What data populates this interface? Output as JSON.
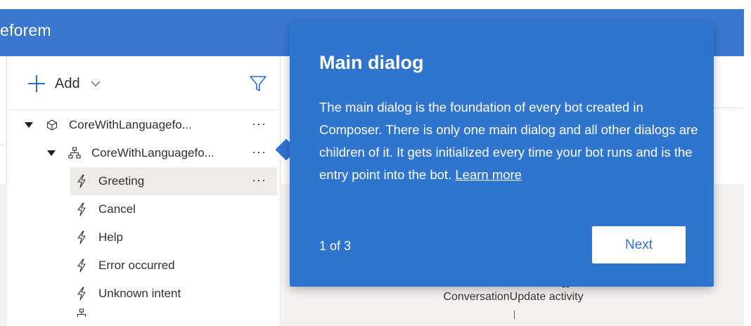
{
  "header": {
    "title": "eforem"
  },
  "toolbar": {
    "add_label": "Add"
  },
  "tree": {
    "items": [
      {
        "label": "CoreWithLanguagefo...",
        "icon": "cube-icon",
        "more": "···"
      },
      {
        "label": "CoreWithLanguagefo...",
        "icon": "sitemap-icon",
        "more": "···"
      },
      {
        "label": "Greeting",
        "icon": "lightning-icon",
        "more": "···"
      },
      {
        "label": "Cancel",
        "icon": "lightning-icon"
      },
      {
        "label": "Help",
        "icon": "lightning-icon"
      },
      {
        "label": "Error occurred",
        "icon": "lightning-icon"
      },
      {
        "label": "Unknown intent",
        "icon": "lightning-icon"
      }
    ]
  },
  "canvas": {
    "subtitle": "ConversationUpdate activity"
  },
  "callout": {
    "title": "Main dialog",
    "body": "The main dialog is the foundation of every bot created in Composer. There is only one main dialog and all other dialogs are children of it. It gets initialized every time your bot runs and is the entry point into the bot.",
    "link": "Learn more",
    "counter": "1 of 3",
    "next_label": "Next"
  },
  "colors": {
    "header": "#3a78d0",
    "callout": "#2f74cf",
    "accent": "#2b6fce",
    "selected_row": "#edebe9"
  }
}
